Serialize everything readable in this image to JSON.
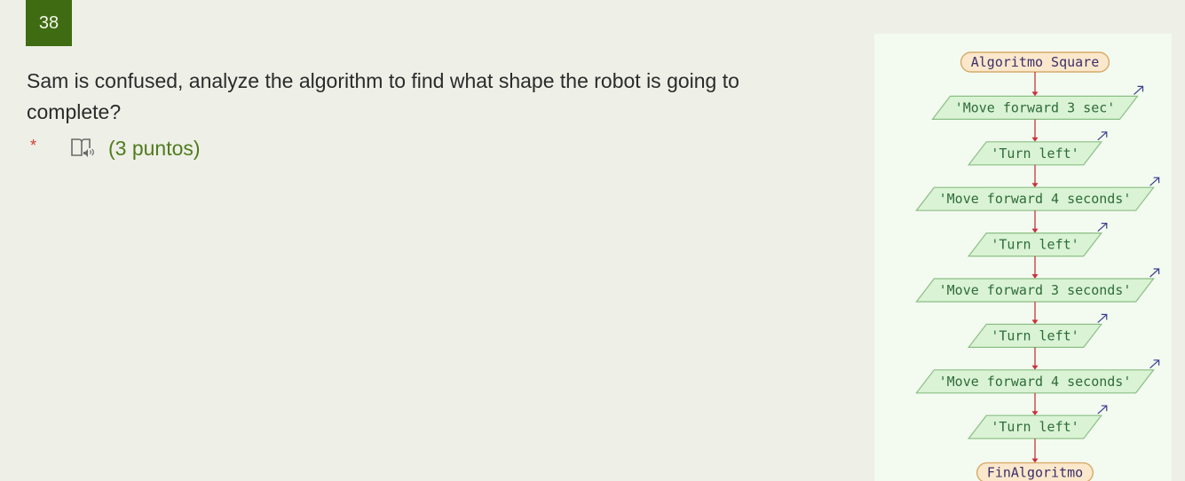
{
  "question": {
    "number": "38",
    "text": "Sam is confused, analyze the algorithm to find what shape the robot is going to complete?",
    "required_marker": "*",
    "reader_icon": "immersive-reader-icon",
    "points": "(3 puntos)"
  },
  "flowchart": {
    "start_label": "Algoritmo Square",
    "end_label": "FinAlgoritmo",
    "steps": [
      "'Move forward 3 sec'",
      "'Turn left'",
      "'Move forward 4 seconds'",
      "'Turn left'",
      "'Move forward 3 seconds'",
      "'Turn left'",
      "'Move forward 4 seconds'",
      "'Turn left'"
    ],
    "output_icon": "output-arrow-icon",
    "colors": {
      "terminal_fill": "#fbe8cc",
      "terminal_stroke": "#d8aa6a",
      "terminal_text": "#3b2f6b",
      "io_fill": "#d9f3d4",
      "io_stroke": "#8bbf84",
      "io_text": "#2f6b3a",
      "connector": "#c8323a",
      "output_arrow": "#3b3f8f"
    }
  }
}
